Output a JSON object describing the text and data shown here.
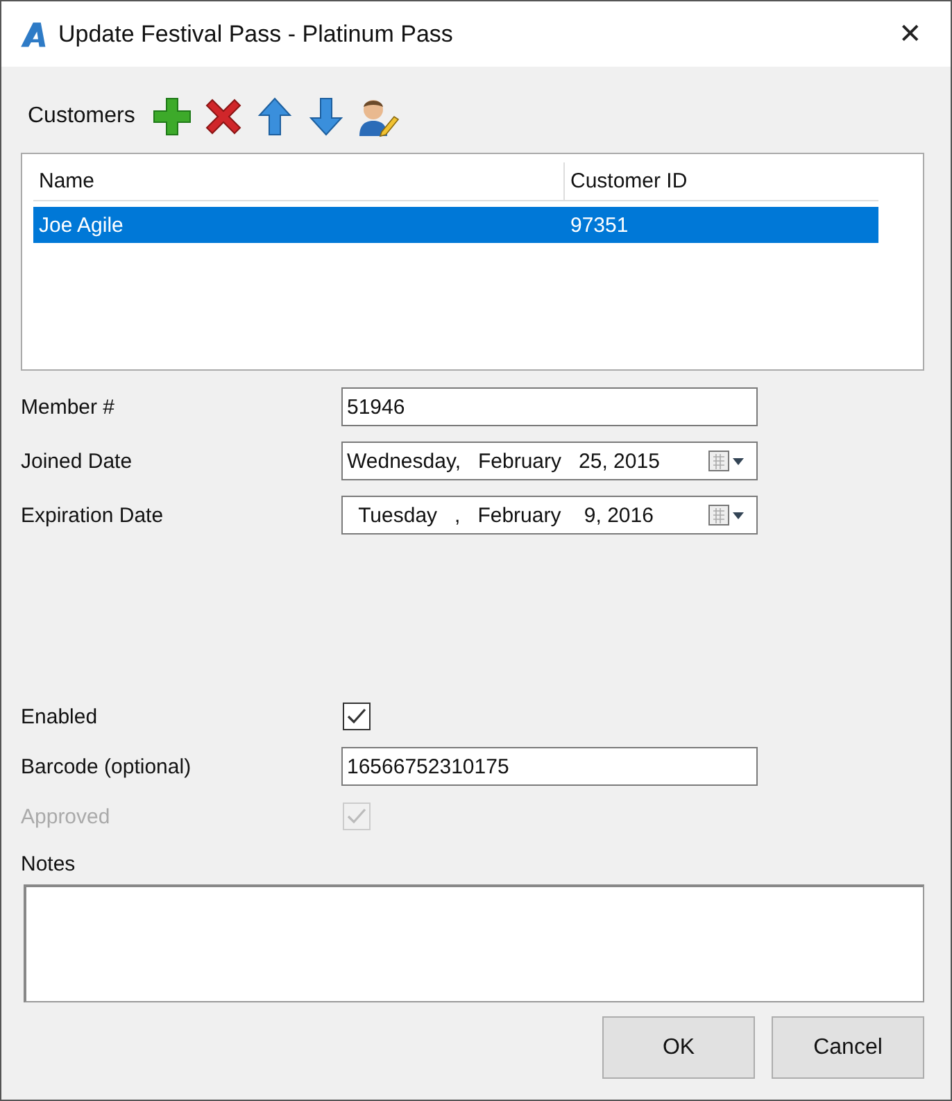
{
  "window": {
    "title": "Update Festival Pass - Platinum Pass",
    "close": "✕"
  },
  "customers": {
    "label": "Customers",
    "columns": [
      "Name",
      "Customer ID"
    ],
    "rows": [
      {
        "cells": [
          "Joe Agile",
          "97351"
        ],
        "selected": true
      }
    ]
  },
  "fields": [
    {
      "kind": "text",
      "label": "Member #",
      "value": "51946"
    },
    {
      "kind": "date",
      "label": "Joined Date",
      "value": "Wednesday,   February   25, 2015"
    },
    {
      "kind": "date",
      "label": "Expiration Date",
      "value": "  Tuesday   ,   February    9, 2016"
    }
  ],
  "options": [
    {
      "kind": "check",
      "label": "Enabled",
      "checked": true,
      "disabled": false
    },
    {
      "kind": "text",
      "label": "Barcode (optional)",
      "value": "16566752310175"
    },
    {
      "kind": "check",
      "label": "Approved",
      "checked": true,
      "disabled": true
    }
  ],
  "notes": {
    "label": "Notes"
  },
  "buttons": [
    "OK",
    "Cancel"
  ]
}
